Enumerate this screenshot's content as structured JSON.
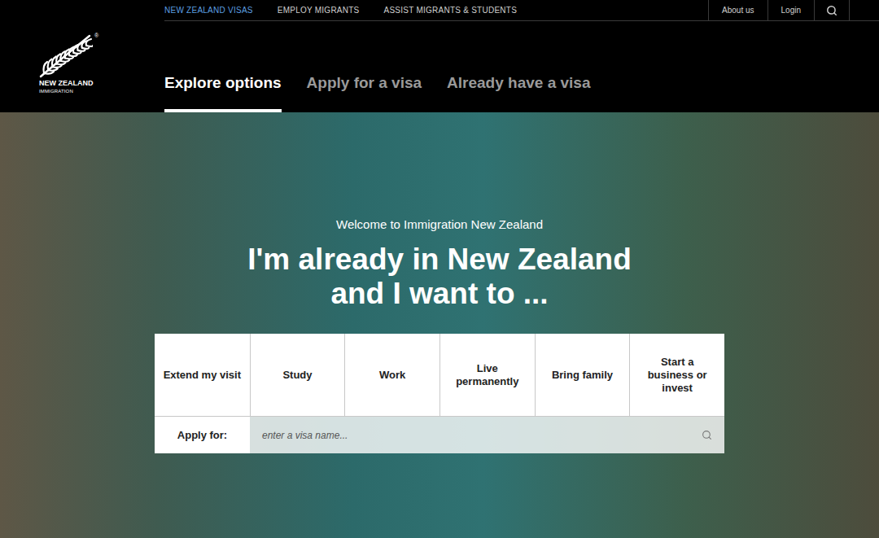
{
  "topNav": {
    "items": [
      {
        "label": "NEW ZEALAND VISAS",
        "selected": true
      },
      {
        "label": "EMPLOY MIGRANTS",
        "selected": false
      },
      {
        "label": "ASSIST MIGRANTS & STUDENTS",
        "selected": false
      }
    ],
    "utility": [
      "About us",
      "Login"
    ]
  },
  "logo": {
    "line1": "NEW ZEALAND",
    "line2": "IMMIGRATION",
    "mark": "®"
  },
  "mainTabs": [
    {
      "label": "Explore options",
      "selected": true
    },
    {
      "label": "Apply for a visa",
      "selected": false
    },
    {
      "label": "Already have a visa",
      "selected": false
    }
  ],
  "hero": {
    "welcome": "Welcome to Immigration New Zealand",
    "headline": [
      "I'm already in New Zealand",
      "and I want to ..."
    ],
    "options": [
      "Extend my visit",
      "Study",
      "Work",
      "Live permanently",
      "Bring family",
      "Start a business or invest"
    ],
    "applyFor": {
      "label": "Apply for:",
      "placeholder": "enter a visa name..."
    }
  }
}
